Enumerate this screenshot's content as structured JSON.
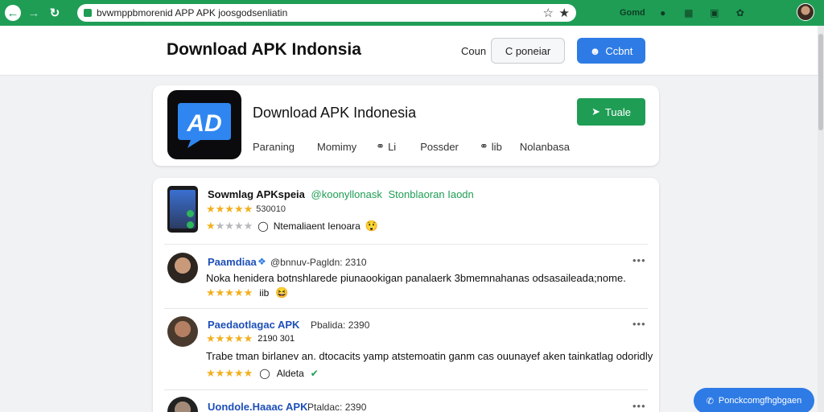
{
  "browser": {
    "url": "bvwmppbmorenid APP APK joosgodsenliatin",
    "extension_label": "Gomd"
  },
  "header": {
    "title": "Download APK Indonsia",
    "link": "Coun",
    "outline_button": "C poneiar",
    "primary_button": "Ccbnt"
  },
  "app": {
    "title": "Download APK Indonesia",
    "install_button": "Tuale",
    "meta": {
      "rating": "Paraning",
      "downloads": "Momimy",
      "share_count": "Li",
      "publisher": "Possder",
      "lib": "lib",
      "category": "Nolanbasa"
    }
  },
  "reviews": {
    "featured": {
      "title": "Sowmlag APKspeia",
      "handle": "@koonyllonask",
      "tag": "Stonblaoran Iaodn",
      "count": "530010",
      "sub_text": "Ntemaliaent Ienoara",
      "stars": 5,
      "sub_stars": 1
    },
    "items": [
      {
        "name": "Paamdiaa",
        "handle": "@bnnuv-Pagldn: 2310",
        "text": "Noka henidera botnshlarede piunaookigan panalaerk 3bmemnahanas odsasaileada;nome.",
        "reaction": "iib",
        "stars": 5
      },
      {
        "name": "Paedaotlagac APK",
        "handle": "Pbalida: 2390",
        "count": "2190 301",
        "text": "Trabe tman birlanev an. dtocacits yamp atstemoatin ganm cas ouunayef aken tainkatlag odoridly",
        "reaction": "Aldeta",
        "stars": 5
      },
      {
        "name": "Uondole.Haaac APK",
        "handle": "Ptaldac: 2390"
      }
    ]
  },
  "fab": {
    "label": "Ponckcomgfhgbgaen"
  },
  "colors": {
    "brand_green": "#1f9d55",
    "primary_blue": "#2e7be5",
    "star_gold": "#f2b01e"
  }
}
